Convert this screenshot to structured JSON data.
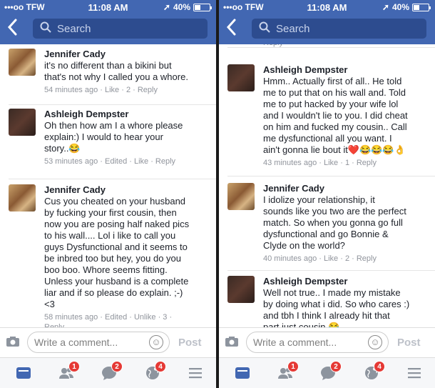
{
  "status_bar": {
    "carrier": "•••oo TFW",
    "time": "11:08 AM",
    "battery": "40%",
    "battery_level": 0.4
  },
  "search": {
    "placeholder": "Search"
  },
  "left": {
    "comments": [
      {
        "name": "Jennifer Cady",
        "avatar": "jennifer",
        "lines": [
          "it's no different than a bikini but",
          "that's not why I called you a whore."
        ],
        "meta": "54 minutes ago · Like · 2 · Reply"
      },
      {
        "name": "Ashleigh Dempster",
        "avatar": "ashleigh",
        "lines": [
          "Oh then how am I a whore please",
          "explain:) I would to hear your",
          "story..😂"
        ],
        "meta": "53 minutes ago · Edited · Like · Reply"
      },
      {
        "name": "Jennifer Cady",
        "avatar": "jennifer",
        "lines": [
          "Cus you cheated on your husband",
          "by fucking your first cousin, then",
          "now you are posing half naked pics",
          "to his wall.... Lol i like to call you",
          "guys Dysfunctional and it seems to",
          "be inbred too but hey, you do you",
          "boo boo. Whore seems fitting.",
          "Unless your husband is a complete",
          "liar and if so please do explain. ;-)",
          "<3"
        ],
        "meta": "58 minutes ago · Edited · Unlike · 3 ·",
        "meta2": "Reply"
      }
    ]
  },
  "right": {
    "top_fragment": "Reply",
    "comments": [
      {
        "name": "Ashleigh Dempster",
        "avatar": "ashleigh",
        "lines": [
          "Hmm.. Actually first of all.. He told",
          "me to put that on his wall and. Told",
          "me to put hacked by your wife lol",
          "and I wouldn't lie to you. I did cheat",
          "on him and fucked my cousin.. Call",
          "me  dysfunctional all you want. I",
          "ain't gonna lie bout it❤️😂😂😂👌"
        ],
        "meta": "43 minutes ago · Like · 1 · Reply"
      },
      {
        "name": "Jennifer Cady",
        "avatar": "jennifer",
        "lines": [
          "I idolize your relationship, it",
          "sounds like you two are the perfect",
          "match. So when you gonna go full",
          "dysfunctional and go Bonnie &",
          "Clyde on the world?"
        ],
        "meta": "40 minutes ago · Like · 2 · Reply"
      },
      {
        "name": "Ashleigh Dempster",
        "avatar": "ashleigh",
        "lines": [
          "Well not true.. I made my mistake",
          "by doing what i did. So who cares :)",
          "and tbh I think I already hit that",
          "part just cousin 😂"
        ],
        "meta": ""
      }
    ]
  },
  "composer": {
    "placeholder": "Write a comment...",
    "post_label": "Post"
  },
  "tabs": [
    {
      "icon": "news-feed-icon",
      "badge": ""
    },
    {
      "icon": "friend-requests-icon",
      "badge": "1"
    },
    {
      "icon": "messages-icon",
      "badge": "2"
    },
    {
      "icon": "notifications-globe-icon",
      "badge": "4"
    },
    {
      "icon": "menu-icon",
      "badge": ""
    }
  ],
  "colors": {
    "brand": "#4267b2",
    "badge": "#e53935"
  }
}
